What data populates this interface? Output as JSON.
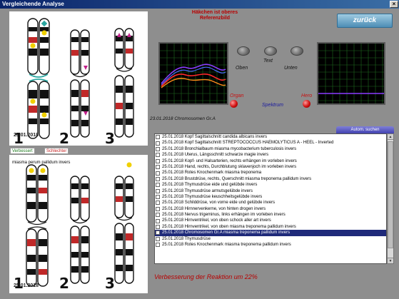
{
  "window": {
    "title": "Vergleichende Analyse",
    "close_glyph": "×"
  },
  "heading": {
    "line1": "Häkchen ist oberes",
    "line2": "Referenzbild"
  },
  "back_button": {
    "label": "zurück"
  },
  "controls": {
    "oben": "Oben",
    "text": "Text",
    "unten": "Unten",
    "organ": "Organ",
    "hero": "Hero",
    "spektrum": "Spektrum"
  },
  "top_panel": {
    "date": "23.01.2018",
    "numbers": [
      "1",
      "2",
      "3"
    ]
  },
  "bottom_panel": {
    "date": "25.01.2018",
    "caption": "miasma         perum         pallidum invers",
    "numbers": [
      "1",
      "2",
      "3"
    ]
  },
  "tabs": {
    "verbessert": "Verbessert",
    "schlechter": "Schlechter"
  },
  "date_line": "23.01.2018 Chromosomen Gr.A",
  "search_button": "Autom. suchen",
  "list": {
    "rows": [
      "25.01.2018  Kopf Sagittalschnitt  candida albicans invers",
      "25.01.2018  Kopf Sagittalschnitt  STREPTOCOCCUS  HAEMOLYTICUS  A   -  HEEL - Inverted",
      "25.01.2018  Bronchialbaum  miasma mycobacterium tuberculosis invers",
      "25.01.2018  Uterus, Längsschnitt  schwarze magie invers",
      "25.01.2018  Kopf- und Halsarterien, rechts  erhängen im vorleben invers",
      "25.01.2018  Hand, rechts, Durchblutung  sklavenjoch im vorleben invers",
      "25.01.2018  Rotes Knochenmark  miasma treponema",
      "25.01.2018  Brustdrüse, rechts, Querschnitt  miasma treponema pallidum invers",
      "25.01.2018  Thymusdrüse  eide und gelübde invers",
      "25.01.2018  Thymusdrüse  armutsgelübde invers",
      "25.01.2018  Thymusdrüse  keuschheitsgelübde invers",
      "25.01.2018  Schilddrüse, von vorne  eide und gelübde invers",
      "25.01.2018  Hirnnervenkerne, von hinten  drogen invers",
      "25.01.2018  Nervus trigeminus, links  erhängen im vorleben invers",
      "25.01.2018  Hirnventrikel, von oben  schock aller art invers",
      "25.01.2018  Hirnventrikel, von oben  miasma treponema pallidum invers",
      "25.01.2018  Chromosomen Gr.A  miasma treponema pallidum invers",
      "25.01.2018  Thymusdrüse",
      "25.01.2018  Rotes Knochenmark  miasma treponema pallidum invers"
    ],
    "selected_index": 16
  },
  "status": "Verbesserung der Reaktion um 22%",
  "colors": {
    "accent_red": "#b80000",
    "selection": "#1f2a7a",
    "scope_purple": "#8a3cff",
    "scope_orange": "#ff8c1a",
    "scope_red": "#ff2a2a",
    "scope_blue": "#4a6cff"
  },
  "icons": {
    "scroll_up": "up-arrow-icon",
    "scroll_down": "down-arrow-icon",
    "close": "close-icon"
  }
}
